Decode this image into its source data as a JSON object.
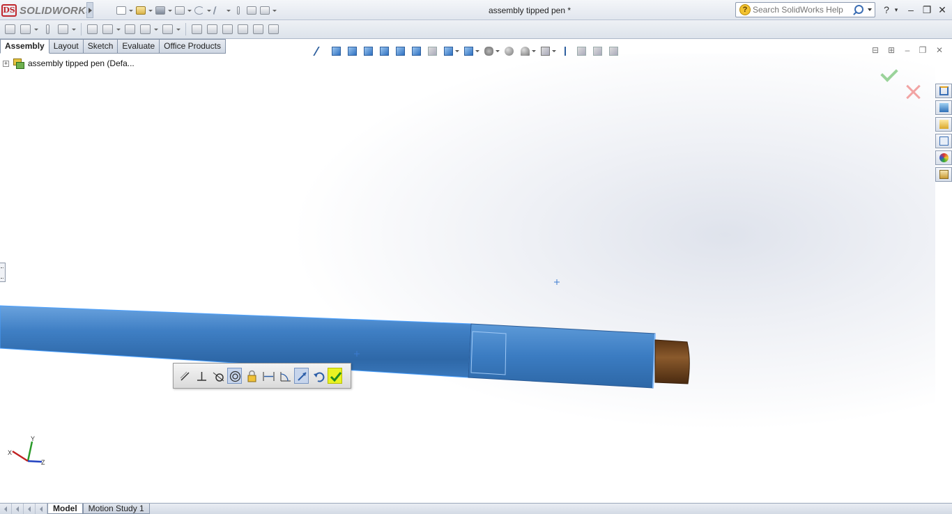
{
  "app": {
    "brand": "SOLIDWORKS",
    "brand_mark": "DS",
    "document_title": "assembly tipped pen *"
  },
  "help_search": {
    "placeholder": "Search SolidWorks Help"
  },
  "quick_access": [
    "new-icon",
    "open-icon",
    "save-icon",
    "print-icon",
    "undo-icon",
    "select-icon",
    "rebuild-icon",
    "file-properties-icon",
    "options-icon"
  ],
  "title_controls": {
    "help": "?",
    "minimize": "–",
    "restore": "❐",
    "close": "✕"
  },
  "command_manager": {
    "tabs": [
      {
        "label": "Assembly",
        "active": true
      },
      {
        "label": "Layout",
        "active": false
      },
      {
        "label": "Sketch",
        "active": false
      },
      {
        "label": "Evaluate",
        "active": false
      },
      {
        "label": "Office Products",
        "active": false
      }
    ]
  },
  "feature_tree": {
    "root_label": "assembly tipped pen  (Defa..."
  },
  "bottom_tabs": [
    {
      "label": "Model",
      "active": true
    },
    {
      "label": "Motion Study 1",
      "active": false
    }
  ],
  "triad": {
    "x": "X",
    "y": "Y",
    "z": "Z"
  },
  "colors": {
    "pen_body": "#3f7fc4",
    "pen_tip": "#7a4a22",
    "accent_confirm": "#e8f222",
    "brand_red": "#c0272d"
  },
  "context_toolbar": [
    "coincident-icon",
    "perpendicular-icon",
    "tangent-icon",
    "concentric-icon",
    "lock-icon",
    "distance-icon",
    "angle-icon",
    "flip-alignment-icon",
    "undo-mate-icon",
    "add-mate-confirm-icon"
  ]
}
